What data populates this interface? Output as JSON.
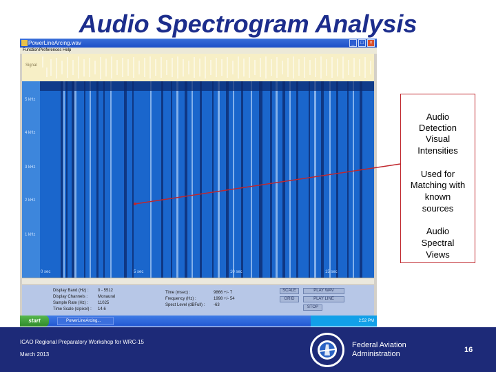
{
  "slide": {
    "title": "Audio Spectrogram Analysis"
  },
  "window": {
    "title": "PowerLineArcing.wav",
    "menu": [
      "Function",
      "Preferences",
      "Help"
    ],
    "controls": {
      "minimize": "_",
      "maximize": "□",
      "close": "×"
    }
  },
  "spectrogram": {
    "signal_label": "Signal",
    "freq_labels": [
      "5 kHz",
      "4 kHz",
      "3 kHz",
      "2 kHz",
      "1 kHz"
    ],
    "time_labels": [
      "0 sec",
      "5 sec",
      "10 sec",
      "15 sec"
    ]
  },
  "info_panel": {
    "display_band_label": "Display Band (Hz) :",
    "display_band_value": "0 - 5512",
    "display_channels_label": "Display Channels :",
    "display_channels_value": "Monaural",
    "sample_rate_label": "Sample Rate (Hz) :",
    "sample_rate_value": "11025",
    "time_scale_label": "Time Scale (s/pixel) :",
    "time_scale_value": "14.6",
    "time_label": "Time (msec) :",
    "time_value": "9866 +/- 7",
    "frequency_label": "Frequency (Hz) :",
    "frequency_value": "1998 +/- 54",
    "level_label": "Spect Level (dBFull) :",
    "level_value": "-63",
    "buttons": {
      "scale": "SCALE",
      "play_wav": "PLAY WAV",
      "grid": "GRID",
      "play_line": "PLAY LINE",
      "stop": "STOP"
    }
  },
  "taskbar": {
    "start": "start",
    "task": "PowerLineArcing...",
    "clock": "2:52 PM"
  },
  "callout": {
    "block1": [
      "Audio",
      "Detection",
      "Visual",
      "Intensities"
    ],
    "block2": [
      "Used for",
      "Matching with",
      "known",
      "sources"
    ],
    "block3": [
      "Audio",
      "Spectral",
      "Views"
    ]
  },
  "footer": {
    "conference": "ICAO Regional Preparatory Workshop for WRC-15",
    "date": "March 2013",
    "org_line1": "Federal Aviation",
    "org_line2": "Administration",
    "page": "16"
  },
  "colors": {
    "title": "#1c2d8c",
    "footer": "#1d2a78",
    "callout_border": "#c0272d",
    "arrow": "#c0272d",
    "spectrogram_bg": "#1a6fd6"
  }
}
